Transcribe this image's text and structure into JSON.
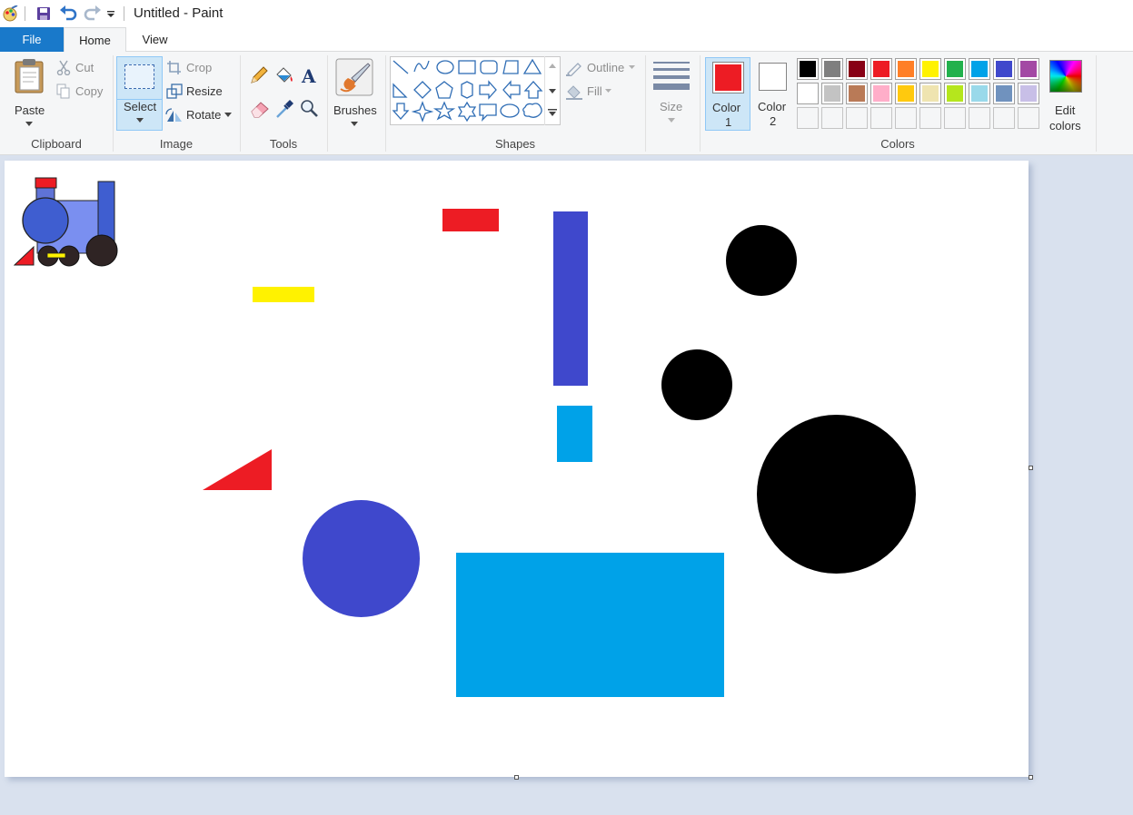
{
  "window": {
    "title": "Untitled - Paint",
    "qat": [
      "paint-app-icon",
      "save-icon",
      "undo-icon",
      "redo-icon",
      "customize-qat-icon"
    ]
  },
  "tabs": [
    "File",
    "Home",
    "View"
  ],
  "ribbon": {
    "clipboard": {
      "label": "Clipboard",
      "paste": "Paste",
      "cut": "Cut",
      "copy": "Copy"
    },
    "image": {
      "label": "Image",
      "select": "Select",
      "crop": "Crop",
      "resize": "Resize",
      "rotate": "Rotate"
    },
    "tools": {
      "label": "Tools"
    },
    "brushes": {
      "label": "Brushes"
    },
    "shapes": {
      "label": "Shapes",
      "outline": "Outline",
      "fill": "Fill"
    },
    "size": {
      "label": "Size"
    },
    "colors": {
      "label": "Colors",
      "color1_label": "Color 1",
      "color2_label": "Color 2",
      "color1_line1": "Color",
      "color1_line2": "1",
      "color2_line1": "Color",
      "color2_line2": "2",
      "color1": "#ed1c24",
      "color2": "#ffffff",
      "edit_line1": "Edit",
      "edit_line2": "colors",
      "palette_row1": [
        "#000000",
        "#7f7f7f",
        "#880015",
        "#ed1c24",
        "#ff7f27",
        "#fff200",
        "#22b14c",
        "#00a2e8",
        "#3f48cc",
        "#a349a4"
      ],
      "palette_row2": [
        "#ffffff",
        "#c3c3c3",
        "#b97a57",
        "#ffaec9",
        "#ffc90e",
        "#efe4b0",
        "#b5e61d",
        "#99d9ea",
        "#7092be",
        "#c8bfe7"
      ]
    }
  },
  "canvas_colors": {
    "red": "#ed1c24",
    "yellow": "#fff200",
    "blue": "#3f48cc",
    "cyan": "#00a2e8",
    "black": "#000000"
  }
}
